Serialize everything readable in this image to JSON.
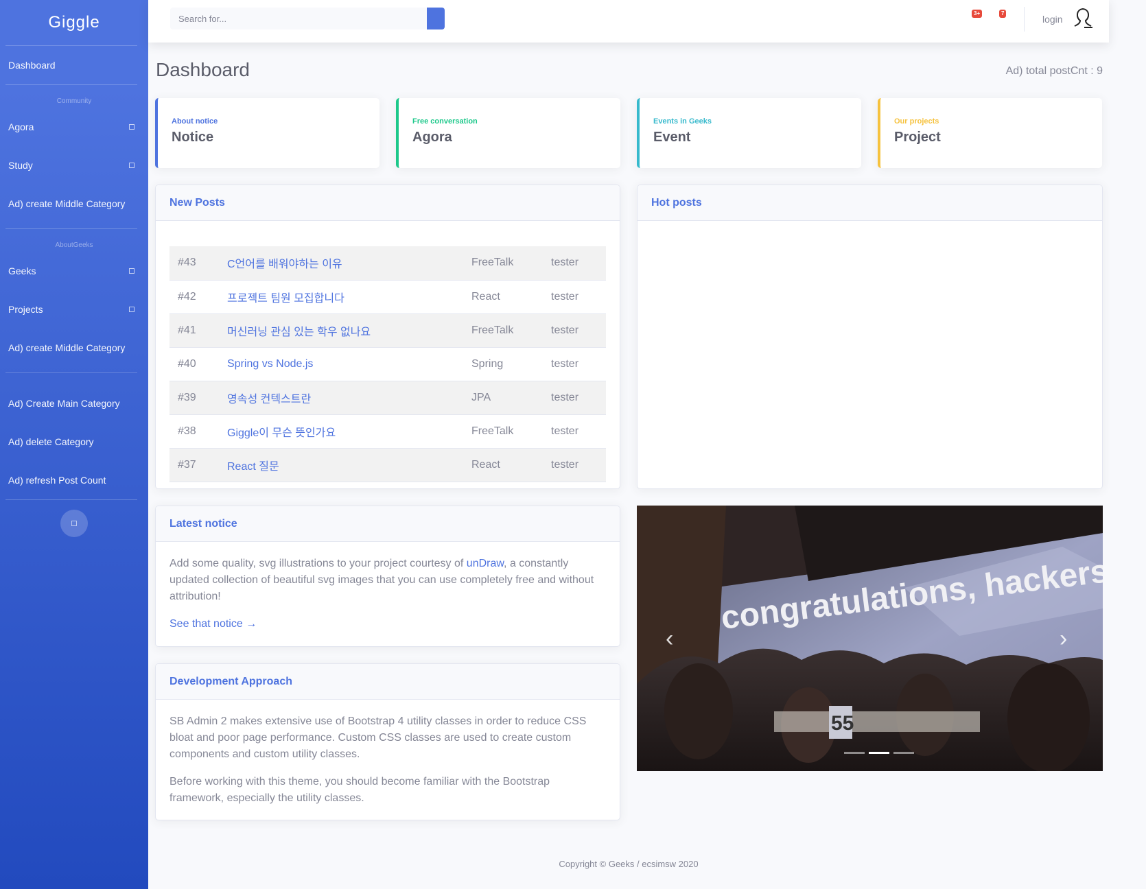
{
  "sidebar": {
    "brand": "Giggle",
    "dashboard": "Dashboard",
    "heading_community": "Community",
    "agora": "Agora",
    "study": "Study",
    "create_middle_1": "Ad) create Middle Category",
    "heading_aboutgeeks": "AboutGeeks",
    "geeks": "Geeks",
    "projects": "Projects",
    "create_middle_2": "Ad) create Middle Category",
    "create_main": "Ad) Create Main Category",
    "delete_category": "Ad) delete Category",
    "refresh_count": "Ad) refresh Post Count"
  },
  "topbar": {
    "search_placeholder": "Search for...",
    "alerts_badge": "3+",
    "messages_badge": "7",
    "login": "login"
  },
  "page": {
    "title": "Dashboard",
    "total_cnt": "Ad) total postCnt : 9"
  },
  "categories": [
    {
      "sub": "About notice",
      "main": "Notice",
      "color": "#4e73df"
    },
    {
      "sub": "Free conversation",
      "main": "Agora",
      "color": "#1cc88a"
    },
    {
      "sub": "Events in Geeks",
      "main": "Event",
      "color": "#36b9cc"
    },
    {
      "sub": "Our projects",
      "main": "Project",
      "color": "#f6c23e"
    }
  ],
  "new_posts": {
    "header": "New Posts",
    "rows": [
      {
        "num": "#43",
        "title": "C언어를 배워야하는 이유",
        "category": "FreeTalk",
        "author": "tester"
      },
      {
        "num": "#42",
        "title": "프로젝트 팀원 모집합니다",
        "category": "React",
        "author": "tester"
      },
      {
        "num": "#41",
        "title": "머신러닝 관심 있는 학우 없나요",
        "category": "FreeTalk",
        "author": "tester"
      },
      {
        "num": "#40",
        "title": "Spring vs Node.js",
        "category": "Spring",
        "author": "tester"
      },
      {
        "num": "#39",
        "title": "영속성 컨텍스트란",
        "category": "JPA",
        "author": "tester"
      },
      {
        "num": "#38",
        "title": "Giggle이 무슨 뜻인가요",
        "category": "FreeTalk",
        "author": "tester"
      },
      {
        "num": "#37",
        "title": "React 질문",
        "category": "React",
        "author": "tester"
      }
    ]
  },
  "hot_posts": {
    "header": "Hot posts"
  },
  "latest_notice": {
    "header": "Latest notice",
    "text_before": "Add some quality, svg illustrations to your project courtesy of ",
    "link": "unDraw",
    "text_after": ", a constantly updated collection of beautiful svg images that you can use completely free and without attribution!",
    "see_link": "See that notice →"
  },
  "dev_approach": {
    "header": "Development Approach",
    "p1": "SB Admin 2 makes extensive use of Bootstrap 4 utility classes in order to reduce CSS bloat and poor page performance. Custom CSS classes are used to create custom components and custom utility classes.",
    "p2": "Before working with this theme, you should become familiar with the Bootstrap framework, especially the utility classes."
  },
  "carousel": {
    "banner_text": "congratulations, hackers",
    "table_number": "55",
    "prev_icon": "chevron-left-icon",
    "next_icon": "chevron-right-icon"
  },
  "footer": {
    "copyright": "Copyright © Geeks / ecsimsw 2020"
  }
}
